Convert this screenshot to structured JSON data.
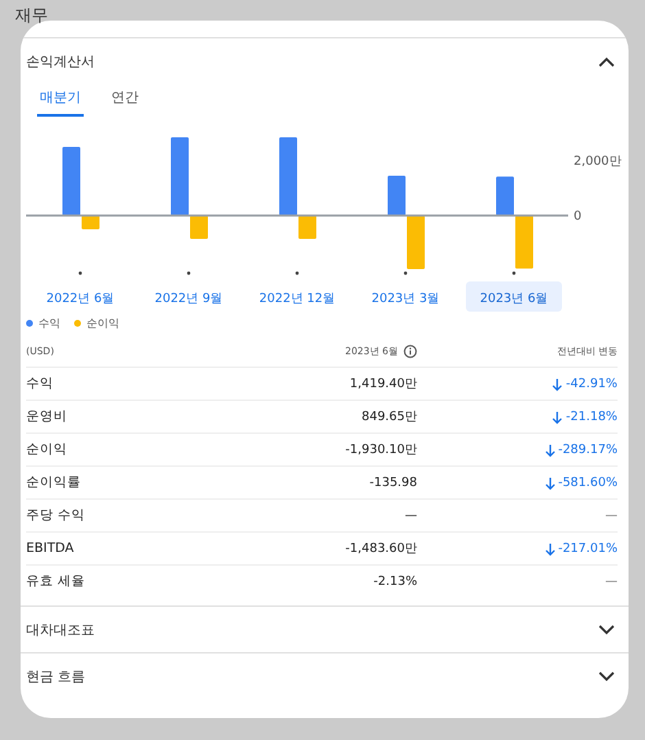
{
  "page_title": "재무",
  "sections": [
    {
      "title": "손익계산서",
      "expanded": true
    },
    {
      "title": "대차대조표",
      "expanded": false
    },
    {
      "title": "현금 흐름",
      "expanded": false
    }
  ],
  "tabs": [
    {
      "label": "매분기",
      "selected": true
    },
    {
      "label": "연간",
      "selected": false
    }
  ],
  "chart_data": {
    "type": "bar",
    "categories": [
      "2022년 6월",
      "2022년 9월",
      "2022년 12월",
      "2023년 3월",
      "2023년 6월"
    ],
    "series": [
      {
        "name": "수익",
        "color": "#4285f4",
        "values": [
          2500,
          2850,
          2850,
          1450,
          1420
        ]
      },
      {
        "name": "순이익",
        "color": "#fbbc04",
        "values": [
          -500,
          -850,
          -850,
          -1950,
          -1930
        ]
      }
    ],
    "legend": true,
    "ylim": [
      -2000,
      3000
    ],
    "yticks": [
      0,
      {
        "value": 2000,
        "label": "2,000만"
      }
    ]
  },
  "periods": [
    {
      "selected": false
    },
    {
      "selected": false
    },
    {
      "selected": false
    },
    {
      "selected": false
    },
    {
      "selected": true
    }
  ],
  "table": {
    "columns": [
      "(USD)",
      "2023년 6월",
      "전년대비 변동"
    ],
    "rows": [
      {
        "label": "수익",
        "value": "1,419.40만",
        "change": "-42.91%",
        "kind": "decrease"
      },
      {
        "label": "운영비",
        "value": "849.65만",
        "change": "-21.18%",
        "kind": "decrease"
      },
      {
        "label": "순이익",
        "value": "-1,930.10만",
        "change": "-289.17%",
        "kind": "decrease"
      },
      {
        "label": "순이익률",
        "value": "-135.98",
        "change": "-581.60%",
        "kind": "decrease"
      },
      {
        "label": "주당 수익",
        "value": "—",
        "change": "—",
        "kind": "empty"
      },
      {
        "label": "EBITDA",
        "value": "-1,483.60만",
        "change": "-217.01%",
        "kind": "decrease"
      },
      {
        "label": "유효 세율",
        "value": "-2.13%",
        "change": "—",
        "kind": "empty"
      }
    ]
  }
}
